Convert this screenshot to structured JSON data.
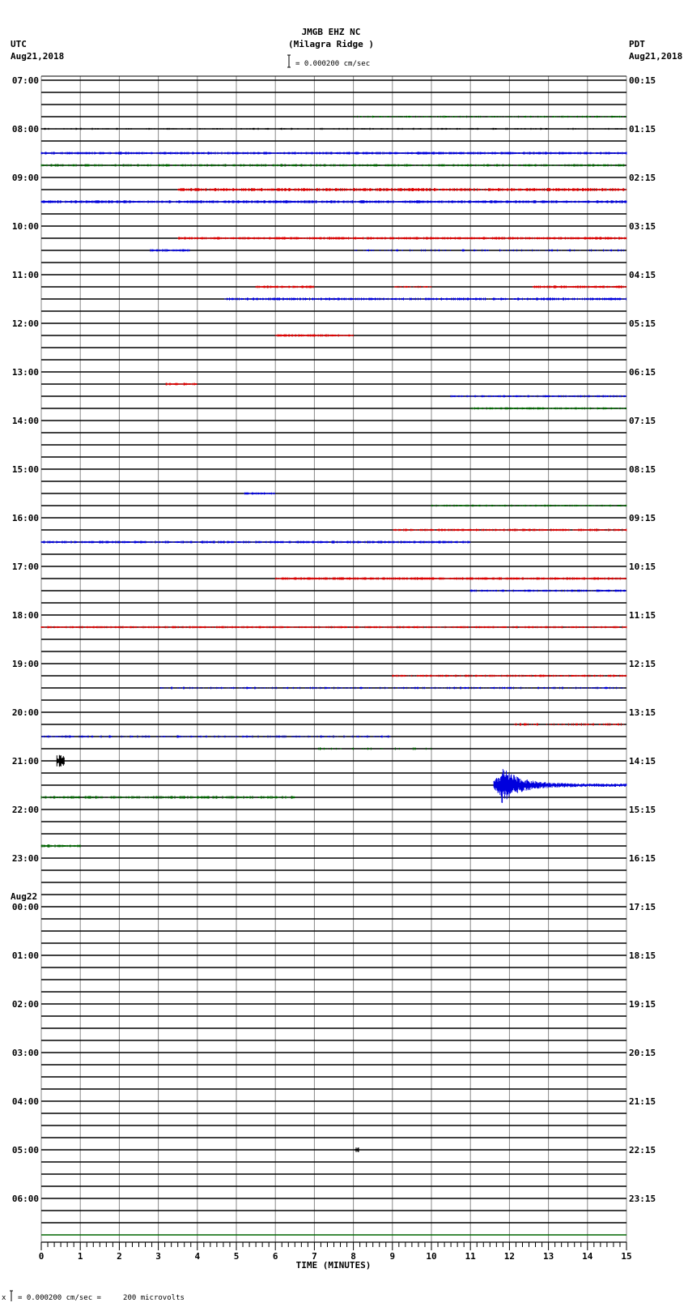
{
  "header": {
    "station": "JMGB EHZ NC",
    "location": "(Milagra Ridge )",
    "left_tz": "UTC",
    "left_date": "Aug21,2018",
    "right_tz": "PDT",
    "right_date": "Aug21,2018",
    "scale_text": "= 0.000200 cm/sec"
  },
  "footer": {
    "scale_text": "= 0.000200 cm/sec =     200 microvolts"
  },
  "chart_data": {
    "type": "line",
    "subtype": "helicorder",
    "title": "JMGB EHZ NC (Milagra Ridge )",
    "xlabel": "TIME (MINUTES)",
    "xlim": [
      0,
      15
    ],
    "x_ticks": [
      "0",
      "1",
      "2",
      "3",
      "4",
      "5",
      "6",
      "7",
      "8",
      "9",
      "10",
      "11",
      "12",
      "13",
      "14",
      "15"
    ],
    "minutes_per_trace": 15,
    "trace_count": 96,
    "trace_colors": [
      "#000000",
      "#dd0000",
      "#0000dd",
      "#006600"
    ],
    "left_labels": [
      "07:00",
      "08:00",
      "09:00",
      "10:00",
      "11:00",
      "12:00",
      "13:00",
      "14:00",
      "15:00",
      "16:00",
      "17:00",
      "18:00",
      "19:00",
      "20:00",
      "21:00",
      "22:00",
      "23:00",
      "00:00",
      "01:00",
      "02:00",
      "03:00",
      "04:00",
      "05:00",
      "06:00"
    ],
    "left_date_change": {
      "hour_index": 17,
      "label": "Aug22"
    },
    "right_labels": [
      "00:15",
      "01:15",
      "02:15",
      "03:15",
      "04:15",
      "05:15",
      "06:15",
      "07:15",
      "08:15",
      "09:15",
      "10:15",
      "11:15",
      "12:15",
      "13:15",
      "14:15",
      "15:15",
      "16:15",
      "17:15",
      "18:15",
      "19:15",
      "20:15",
      "21:15",
      "22:15",
      "23:15"
    ],
    "segments": [
      {
        "trace": 3,
        "from": 8,
        "to": 15,
        "amp": 0.6,
        "density": 0.6
      },
      {
        "trace": 4,
        "from": 0,
        "to": 15,
        "amp": 0.6,
        "density": 0.3
      },
      {
        "trace": 6,
        "from": 0,
        "to": 15,
        "amp": 0.8,
        "density": 1
      },
      {
        "trace": 7,
        "from": 0,
        "to": 15,
        "amp": 0.8,
        "density": 0.7
      },
      {
        "trace": 9,
        "from": 3.5,
        "to": 15,
        "amp": 1.0,
        "density": 0.9
      },
      {
        "trace": 10,
        "from": 0,
        "to": 15,
        "amp": 0.9,
        "density": 1
      },
      {
        "trace": 13,
        "from": 3.5,
        "to": 15,
        "amp": 0.8,
        "density": 1
      },
      {
        "trace": 14,
        "from": 2.8,
        "to": 3.8,
        "amp": 0.8,
        "density": 1
      },
      {
        "trace": 14,
        "from": 8,
        "to": 15,
        "amp": 0.7,
        "density": 0.3
      },
      {
        "trace": 17,
        "from": 5.5,
        "to": 7,
        "amp": 0.8,
        "density": 1
      },
      {
        "trace": 17,
        "from": 9,
        "to": 10,
        "amp": 0.6,
        "density": 0.6
      },
      {
        "trace": 17,
        "from": 12.6,
        "to": 15,
        "amp": 0.8,
        "density": 1
      },
      {
        "trace": 18,
        "from": 4.7,
        "to": 15,
        "amp": 0.8,
        "density": 0.9
      },
      {
        "trace": 21,
        "from": 6,
        "to": 8,
        "amp": 0.8,
        "density": 1
      },
      {
        "trace": 25,
        "from": 3.2,
        "to": 4,
        "amp": 0.8,
        "density": 1
      },
      {
        "trace": 26,
        "from": 10.5,
        "to": 15,
        "amp": 0.7,
        "density": 0.8
      },
      {
        "trace": 27,
        "from": 11,
        "to": 15,
        "amp": 0.7,
        "density": 0.9
      },
      {
        "trace": 34,
        "from": 5.2,
        "to": 6,
        "amp": 0.7,
        "density": 1
      },
      {
        "trace": 35,
        "from": 10,
        "to": 15,
        "amp": 0.6,
        "density": 0.8
      },
      {
        "trace": 37,
        "from": 9,
        "to": 15,
        "amp": 0.8,
        "density": 0.9
      },
      {
        "trace": 38,
        "from": 0,
        "to": 11,
        "amp": 0.8,
        "density": 0.9
      },
      {
        "trace": 41,
        "from": 6,
        "to": 15,
        "amp": 0.8,
        "density": 1
      },
      {
        "trace": 42,
        "from": 11,
        "to": 15,
        "amp": 0.7,
        "density": 0.9
      },
      {
        "trace": 45,
        "from": 0,
        "to": 15,
        "amp": 0.7,
        "density": 0.9
      },
      {
        "trace": 49,
        "from": 9,
        "to": 15,
        "amp": 0.7,
        "density": 0.8
      },
      {
        "trace": 50,
        "from": 3,
        "to": 15,
        "amp": 0.7,
        "density": 0.4
      },
      {
        "trace": 53,
        "from": 12,
        "to": 15,
        "amp": 0.8,
        "density": 0.4
      },
      {
        "trace": 54,
        "from": 0,
        "to": 9,
        "amp": 0.8,
        "density": 0.4
      },
      {
        "trace": 55,
        "from": 7,
        "to": 10,
        "amp": 0.8,
        "density": 0.2
      },
      {
        "trace": 56,
        "from": 0.4,
        "to": 0.6,
        "amp": 4,
        "density": 1
      },
      {
        "trace": 59,
        "from": 0,
        "to": 6.5,
        "amp": 0.9,
        "density": 0.7
      },
      {
        "trace": 63,
        "from": 0,
        "to": 1,
        "amp": 0.9,
        "density": 1
      },
      {
        "trace": 88,
        "from": 8.05,
        "to": 8.15,
        "amp": 2,
        "density": 1
      }
    ],
    "events": [
      {
        "trace": 58,
        "onset_min": 11.6,
        "peak_min": 11.8,
        "end_min": 15,
        "peak_amp_traces": 1.4
      }
    ]
  }
}
